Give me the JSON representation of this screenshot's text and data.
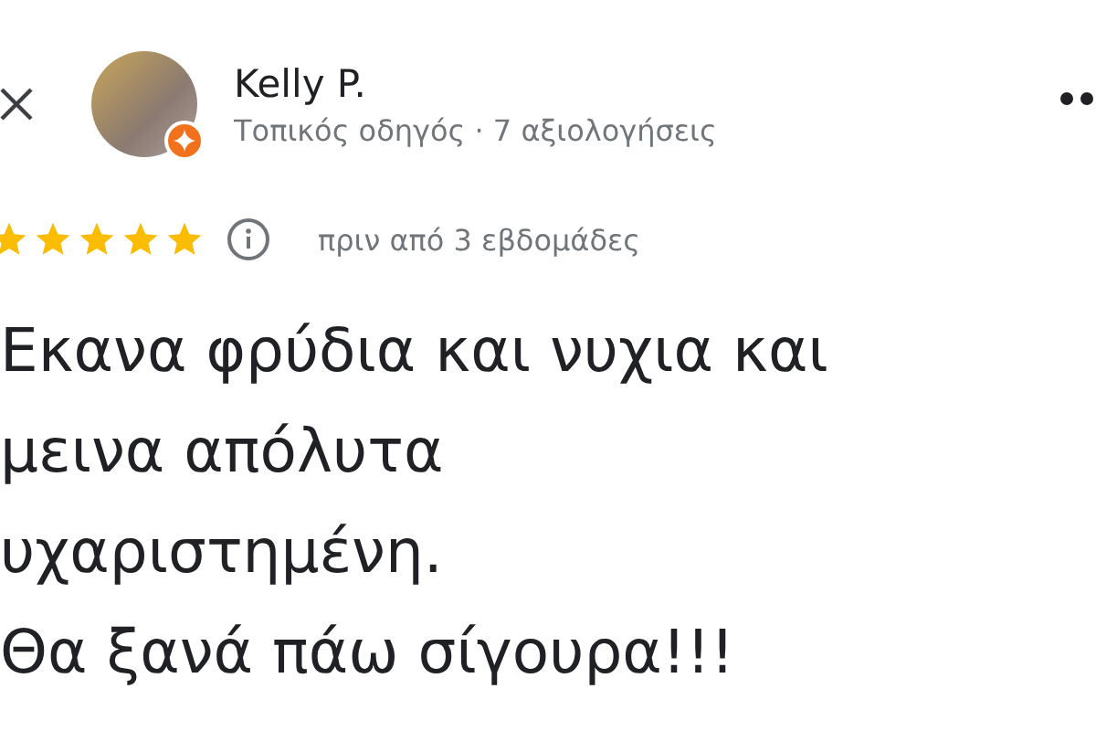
{
  "reviewer": {
    "name": "Kelly P.",
    "subtitle": "Τοπικός οδηγός · 7 αξιολογήσεις",
    "local_guide": true
  },
  "rating": {
    "stars": 5,
    "time": "πριν από 3 εβδομάδες"
  },
  "review_lines": [
    "Εκανα φρύδια και νυχια και",
    "μεινα απόλυτα",
    "υχαριστημένη.",
    "Θα ξανά πάω σίγουρα!!!"
  ]
}
